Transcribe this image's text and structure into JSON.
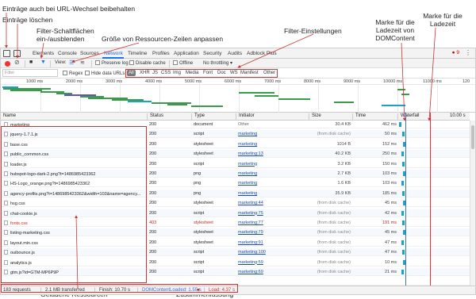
{
  "annotations": {
    "keep_entries": "Einträge auch bei URL-Wechsel beibehalten",
    "clear_entries": "Einträge löschen",
    "filter_buttons": "Filter-Schaltflächen",
    "filter_toggle": "ein-/ausblenden",
    "row_size": "Größe von Ressourcen-Zeilen anpassen",
    "filter_settings": "Filter-Einstellungen",
    "dcl_marker_1": "Marke für die",
    "dcl_marker_2": "Ladezeit von",
    "dcl_marker_3": "DOMContent",
    "load_marker_1": "Marke für die",
    "load_marker_2": "Ladezeit",
    "loaded_resources": "Geladene Ressourcen",
    "summary": "Zusammenfassung"
  },
  "tabs": [
    "Elements",
    "Console",
    "Sources",
    "Network",
    "Timeline",
    "Profiles",
    "Application",
    "Security",
    "Audits",
    "Adblock Plus"
  ],
  "active_tab": "Network",
  "error_count": "9",
  "toolbar": {
    "view_label": "View:",
    "preserve_log": "Preserve log",
    "disable_cache": "Disable cache",
    "offline": "Offline",
    "throttling": "No throttling"
  },
  "filterbar": {
    "placeholder": "Filter",
    "regex": "Regex",
    "hide_data_urls": "Hide data URLs",
    "types": [
      "All",
      "XHR",
      "JS",
      "CSS",
      "Img",
      "Media",
      "Font",
      "Doc",
      "WS",
      "Manifest",
      "Other"
    ]
  },
  "ruler": [
    "1000 ms",
    "2000 ms",
    "3000 ms",
    "4000 ms",
    "5000 ms",
    "6000 ms",
    "7000 ms",
    "8000 ms",
    "9000 ms",
    "10000 ms",
    "11000 ms",
    "120"
  ],
  "columns": {
    "name": "Name",
    "status": "Status",
    "type": "Type",
    "initiator": "Initiator",
    "size": "Size",
    "time": "Time",
    "waterfall": "Waterfall",
    "waterfall_time": "10.00 s"
  },
  "rows": [
    {
      "name": "marketing",
      "status": "200",
      "type": "document",
      "initiator": "Other",
      "size": "30.4 KB",
      "time": "462 ms"
    },
    {
      "name": "jquery-1.7.1.js",
      "status": "200",
      "type": "script",
      "initiator": "marketing",
      "size": "(from disk cache)",
      "time": "50 ms"
    },
    {
      "name": "base.css",
      "status": "200",
      "type": "stylesheet",
      "initiator": "marketing",
      "size": "1014 B",
      "time": "152 ms"
    },
    {
      "name": "public_common.css",
      "status": "200",
      "type": "stylesheet",
      "initiator": "marketing:13",
      "size": "40.2 KB",
      "time": "250 ms"
    },
    {
      "name": "loader.js",
      "status": "200",
      "type": "script",
      "initiator": "marketing",
      "size": "3.2 KB",
      "time": "150 ms"
    },
    {
      "name": "hubspot-logo-dark-2.png?t=1486985423362",
      "status": "200",
      "type": "png",
      "initiator": "marketing",
      "size": "2.7 KB",
      "time": "103 ms"
    },
    {
      "name": "HS-Logo_orange.png?t=1486985423362",
      "status": "200",
      "type": "png",
      "initiator": "marketing",
      "size": "1.6 KB",
      "time": "103 ms"
    },
    {
      "name": "agency-profits.png?t=1486985423362&width=103&name=agency...",
      "status": "200",
      "type": "png",
      "initiator": "marketing",
      "size": "35.9 KB",
      "time": "185 ms"
    },
    {
      "name": "hsg.css",
      "status": "200",
      "type": "stylesheet",
      "initiator": "marketing:44",
      "size": "(from disk cache)",
      "time": "45 ms"
    },
    {
      "name": "chat-cookie.js",
      "status": "200",
      "type": "script",
      "initiator": "marketing:75",
      "size": "(from disk cache)",
      "time": "42 ms"
    },
    {
      "name": "fonts.css",
      "status": "403",
      "type": "stylesheet",
      "initiator": "marketing:77",
      "size": "(from disk cache)",
      "time": "191 ms",
      "error": true
    },
    {
      "name": "listing-marketing.css",
      "status": "200",
      "type": "stylesheet",
      "initiator": "marketing:79",
      "size": "(from disk cache)",
      "time": "45 ms"
    },
    {
      "name": "layout.min.css",
      "status": "200",
      "type": "stylesheet",
      "initiator": "marketing:91",
      "size": "(from disk cache)",
      "time": "47 ms"
    },
    {
      "name": "ouibounce.js",
      "status": "200",
      "type": "script",
      "initiator": "marketing:100",
      "size": "(from disk cache)",
      "time": "47 ms"
    },
    {
      "name": "analytics.js",
      "status": "200",
      "type": "script",
      "initiator": "marketing:59",
      "size": "(from disk cache)",
      "time": "10 ms"
    },
    {
      "name": "gtm.js?id=GTM-MP6P9P",
      "status": "200",
      "type": "script",
      "initiator": "marketing:69",
      "size": "(from disk cache)",
      "time": "21 ms"
    },
    {
      "name": "",
      "status": "",
      "type": "",
      "initiator": "",
      "size": "",
      "time": ""
    }
  ],
  "statusbar": {
    "requests": "183 requests",
    "transferred": "2.1 MB transferred",
    "finish": "Finish: 10.70 s",
    "dcl": "DOMContentLoaded: 1.55 s",
    "load": "Load: 4.37 s"
  },
  "colors": {
    "accent": "#1a73e8",
    "record": "#e33333",
    "error": "#cc2222",
    "dcl_line": "#3b6fd6",
    "load_line": "#d33333"
  }
}
